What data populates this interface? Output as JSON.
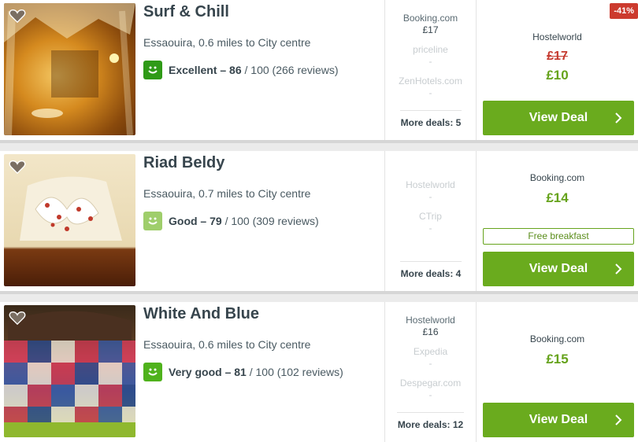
{
  "colors": {
    "excellent": "#2f9a17",
    "good": "#9fce6b",
    "very_good": "#4fb21c",
    "price_green": "#66a31c",
    "button_green": "#6aab1e",
    "discount_red": "#cc3a2e"
  },
  "icons": {
    "favorite": "heart-icon",
    "rating": "smiley-icon",
    "button": "chevron-right-icon"
  },
  "hotels": [
    {
      "name": "Surf & Chill",
      "location": "Essaouira, 0.6 miles to City centre",
      "rating_label": "Excellent – 86",
      "rating_rest": " / 100 (266 reviews)",
      "deals": [
        {
          "site": "Booking.com",
          "price": "£17"
        },
        {
          "site": "priceline",
          "price": "-"
        },
        {
          "site": "ZenHotels.com",
          "price": "-"
        }
      ],
      "more_deals": "More deals: 5",
      "best_provider": "Hostelworld",
      "old_price": "£17",
      "price": "£10",
      "discount": "-41%",
      "button": "View Deal"
    },
    {
      "name": "Riad Beldy",
      "location": "Essaouira, 0.7 miles to City centre",
      "rating_label": "Good – 79",
      "rating_rest": " / 100 (309 reviews)",
      "deals": [
        {
          "site": "Hostelworld",
          "price": "-"
        },
        {
          "site": "CTrip",
          "price": "-"
        }
      ],
      "more_deals": "More deals: 4",
      "best_provider": "Booking.com",
      "price": "£14",
      "free_tag": "Free breakfast",
      "button": "View Deal"
    },
    {
      "name": "White And Blue",
      "location": "Essaouira, 0.6 miles to City centre",
      "rating_label": "Very good – 81",
      "rating_rest": " / 100 (102 reviews)",
      "deals": [
        {
          "site": "Hostelworld",
          "price": "£16"
        },
        {
          "site": "Expedia",
          "price": "-"
        },
        {
          "site": "Despegar.com",
          "price": "-"
        }
      ],
      "more_deals": "More deals: 12",
      "best_provider": "Booking.com",
      "price": "£15",
      "button": "View Deal"
    }
  ]
}
